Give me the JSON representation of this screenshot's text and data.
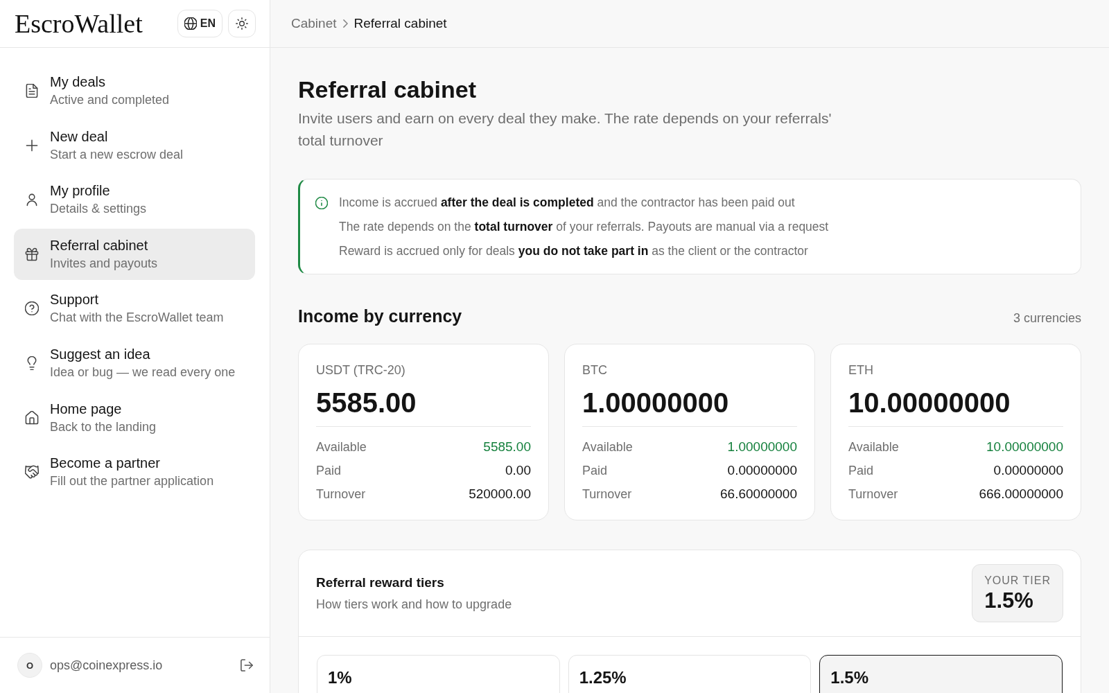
{
  "sidebar": {
    "logo": "EscroWallet",
    "language_button": "EN",
    "nav_items": [
      {
        "title": "My deals",
        "subtitle": "Active and completed",
        "selected": false
      },
      {
        "title": "New deal",
        "subtitle": "Start a new escrow deal",
        "selected": false
      },
      {
        "title": "My profile",
        "subtitle": "Details & settings",
        "selected": false
      },
      {
        "title": "Referral cabinet",
        "subtitle": "Invites and payouts",
        "selected": true
      },
      {
        "title": "Support",
        "subtitle": "Chat with the EscroWallet team",
        "selected": false
      },
      {
        "title": "Suggest an idea",
        "subtitle": "Idea or bug — we read every one",
        "selected": false
      },
      {
        "title": "Home page",
        "subtitle": "Back to the landing",
        "selected": false
      },
      {
        "title": "Become a partner",
        "subtitle": "Fill out the partner application",
        "selected": false
      }
    ],
    "user": {
      "avatar_initial": "O",
      "email": "ops@coinexpress.io"
    }
  },
  "breadcrumb": [
    "Cabinet",
    "Referral cabinet"
  ],
  "page": {
    "title": "Referral cabinet",
    "subtitle": "Invite users and earn on every deal they make. The rate depends on your referrals' total turnover"
  },
  "info_notes": [
    "Income is accrued **after the deal is completed** and the contractor has been paid out",
    "The rate depends on the **total turnover** of your referrals. Payouts are manual via a request",
    "Reward is accrued only for deals **you do not take part in** as the client or the contractor"
  ],
  "income": {
    "title": "Income by currency",
    "count": "3 currencies",
    "currencies": [
      {
        "name": "USDT (TRC-20)",
        "total": "5585.00",
        "stats": [
          {
            "label": "Available",
            "value": "5585.00",
            "kind": "accent"
          },
          {
            "label": "Paid",
            "value": "0.00",
            "kind": "plain"
          },
          {
            "label": "Turnover",
            "value": "520000.00",
            "kind": "plain"
          }
        ]
      },
      {
        "name": "BTC",
        "total": "1.00000000",
        "stats": [
          {
            "label": "Available",
            "value": "1.00000000",
            "kind": "accent"
          },
          {
            "label": "Paid",
            "value": "0.00000000",
            "kind": "plain"
          },
          {
            "label": "Turnover",
            "value": "66.60000000",
            "kind": "plain"
          }
        ]
      },
      {
        "name": "ETH",
        "total": "10.00000000",
        "stats": [
          {
            "label": "Available",
            "value": "10.00000000",
            "kind": "accent"
          },
          {
            "label": "Paid",
            "value": "0.00000000",
            "kind": "plain"
          },
          {
            "label": "Turnover",
            "value": "666.00000000",
            "kind": "plain"
          }
        ]
      }
    ]
  },
  "tiers": {
    "title": "Referral reward tiers",
    "subtitle": "How tiers work and how to upgrade",
    "current_label": "YOUR TIER",
    "current_value": "1.5%",
    "items": [
      {
        "rate": "1%",
        "selected": false
      },
      {
        "rate": "1.25%",
        "selected": false
      },
      {
        "rate": "1.5%",
        "selected": true
      }
    ]
  }
}
